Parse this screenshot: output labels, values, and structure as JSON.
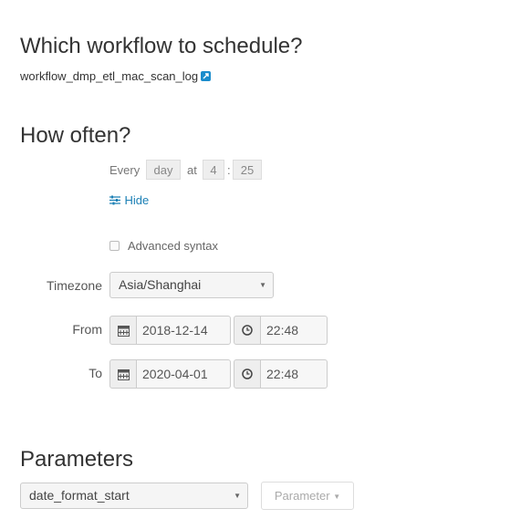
{
  "workflow": {
    "heading": "Which workflow to schedule?",
    "name": "workflow_dmp_etl_mac_scan_log",
    "link_icon": "external-link-icon"
  },
  "frequency": {
    "heading": "How often?",
    "every_label": "Every",
    "unit": "day",
    "at_label": "at",
    "hour": "4",
    "separator": ":",
    "minute": "25",
    "hide_icon": "sliders-icon",
    "hide_label": "Hide",
    "advanced_label": "Advanced syntax",
    "advanced_checked": false
  },
  "timezone": {
    "label": "Timezone",
    "value": "Asia/Shanghai"
  },
  "from": {
    "label": "From",
    "date": "2018-12-14",
    "time": "22:48"
  },
  "to": {
    "label": "To",
    "date": "2020-04-01",
    "time": "22:48"
  },
  "parameters": {
    "heading": "Parameters",
    "selected": "date_format_start",
    "button_label": "Parameter"
  },
  "colors": {
    "link": "#1a7fb5",
    "icon_blue": "#1a8ccc"
  }
}
